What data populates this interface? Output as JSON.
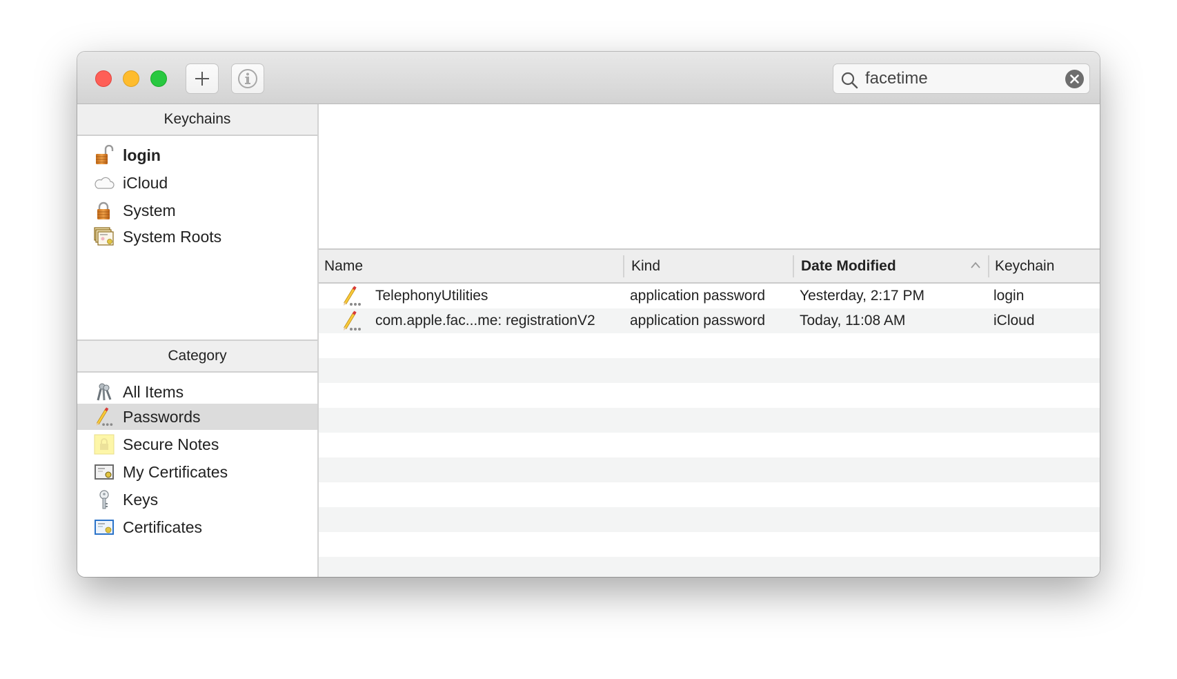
{
  "window": {
    "toolbar": {
      "add_button_label": "+",
      "info_button_icon": "info-icon",
      "search": {
        "value": "facetime",
        "placeholder": "Search",
        "icon": "search-icon",
        "clear_icon": "clear-icon"
      }
    }
  },
  "sidebar": {
    "keychains_header": "Keychains",
    "keychains": [
      {
        "label": "login",
        "icon": "unlocked-padlock-icon",
        "bold": true
      },
      {
        "label": "iCloud",
        "icon": "cloud-icon"
      },
      {
        "label": "System",
        "icon": "locked-padlock-icon"
      },
      {
        "label": "System Roots",
        "icon": "certificate-stack-icon"
      }
    ],
    "category_header": "Category",
    "categories": [
      {
        "label": "All Items",
        "icon": "keys-icon"
      },
      {
        "label": "Passwords",
        "icon": "pencil-password-icon",
        "selected": true
      },
      {
        "label": "Secure Notes",
        "icon": "secure-note-icon"
      },
      {
        "label": "My Certificates",
        "icon": "my-certificate-icon"
      },
      {
        "label": "Keys",
        "icon": "key-icon"
      },
      {
        "label": "Certificates",
        "icon": "certificate-icon"
      }
    ]
  },
  "table": {
    "columns": [
      {
        "label": "Name"
      },
      {
        "label": "Kind"
      },
      {
        "label": "Date Modified",
        "sorted": true,
        "sort_direction": "ascending"
      },
      {
        "label": "Keychain"
      }
    ],
    "rows": [
      {
        "name": "TelephonyUtilities",
        "kind": "application password",
        "date": "Yesterday, 2:17 PM",
        "keychain": "login",
        "icon": "pencil-password-icon"
      },
      {
        "name": "com.apple.fac...me: registrationV2",
        "kind": "application password",
        "date": "Today, 11:08 AM",
        "keychain": "iCloud",
        "icon": "pencil-password-icon"
      }
    ]
  },
  "colors": {
    "close": "#fe5f57",
    "minimize": "#febc2e",
    "maximize": "#28c840",
    "selection": "#dcdcdc",
    "stripe": "#f3f4f4"
  }
}
